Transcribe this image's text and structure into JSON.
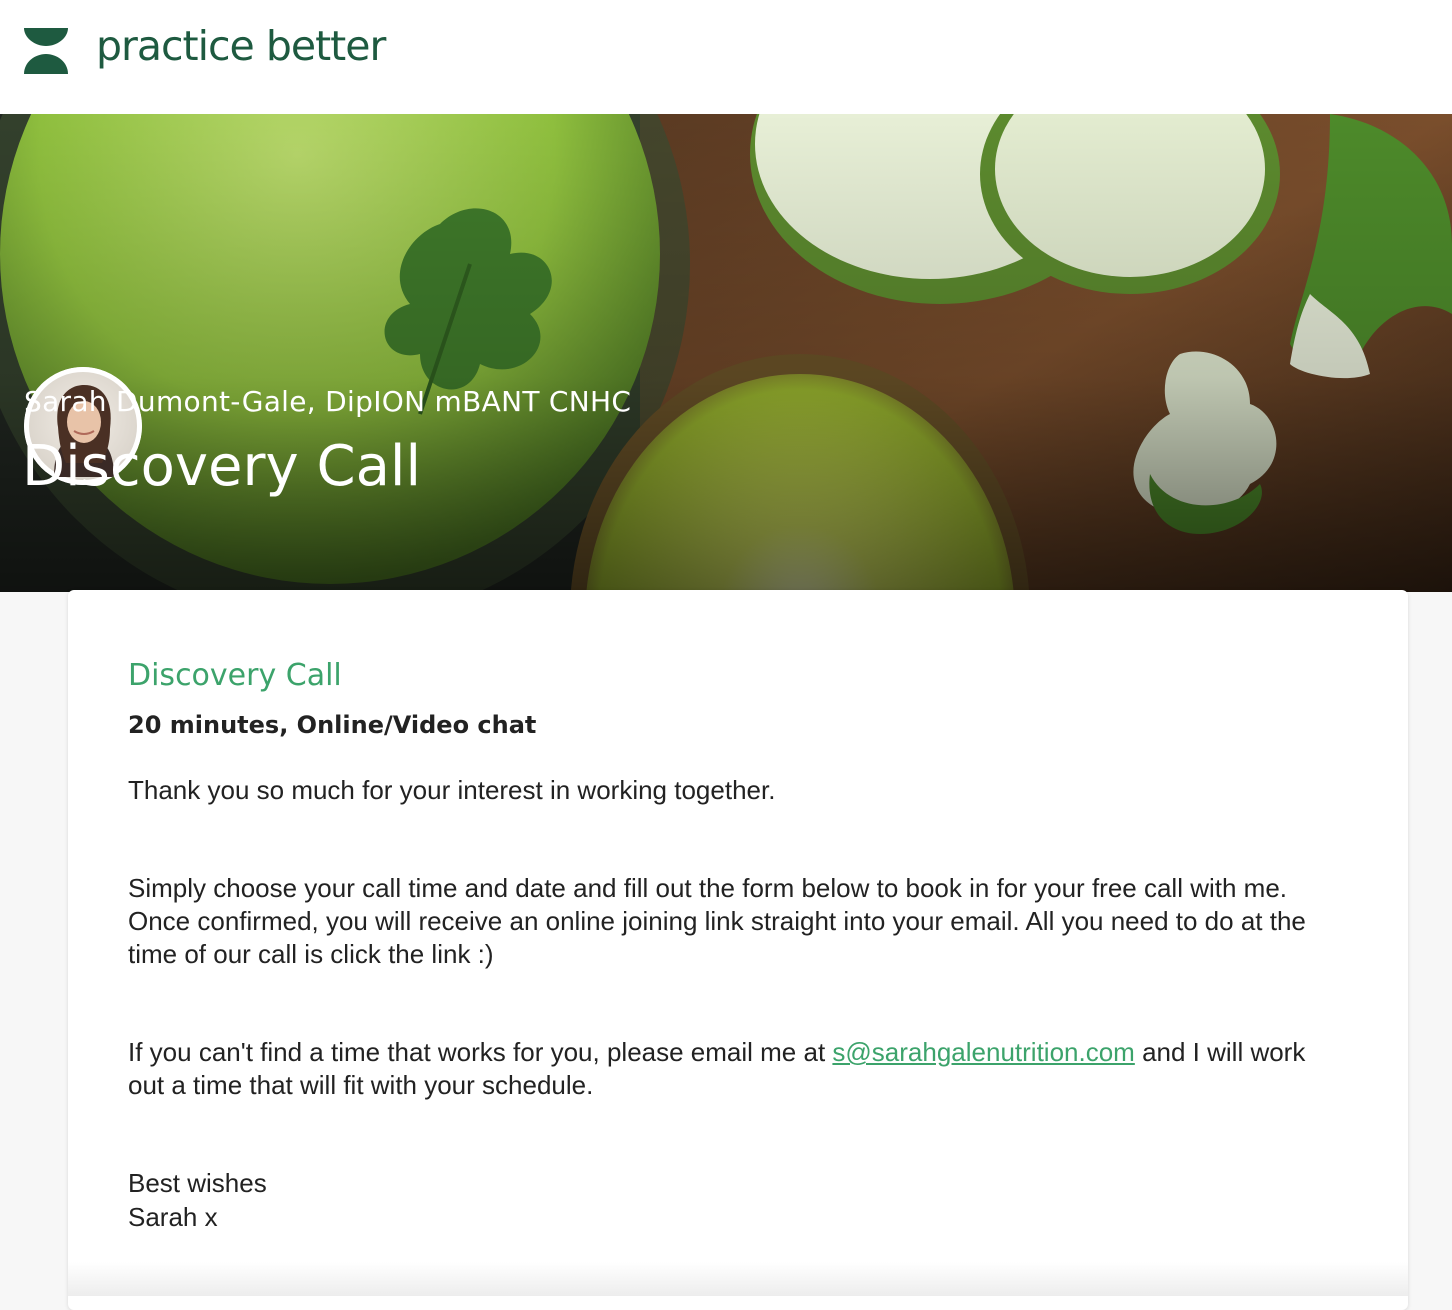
{
  "brand": {
    "name": "practice better",
    "logo_icon": "practice-better-logo-icon",
    "color": "#1e5a40"
  },
  "hero": {
    "provider_name": "Sarah Dumont-Gale, DipION mBANT CNHC",
    "title": "Discovery Call",
    "avatar_icon": "provider-avatar"
  },
  "service": {
    "title": "Discovery Call",
    "meta": "20 minutes, Online/Video chat",
    "accent": "#3ca36b",
    "description": {
      "p1": "Thank you so much for your interest in working together.",
      "p2": "Simply choose your call time and date and fill out the form below to book in for your free call with me. Once confirmed, you will receive an online joining link straight into your email. All you need to do at the time of our call is click the link :)",
      "p3_before": "If you can't find a time that works for you, please email me at ",
      "p3_link": "s@sarahgalenutrition.com",
      "p3_after": " and I will work out a time that will fit with your schedule.",
      "p4": "Best wishes",
      "p5": "Sarah x"
    }
  }
}
